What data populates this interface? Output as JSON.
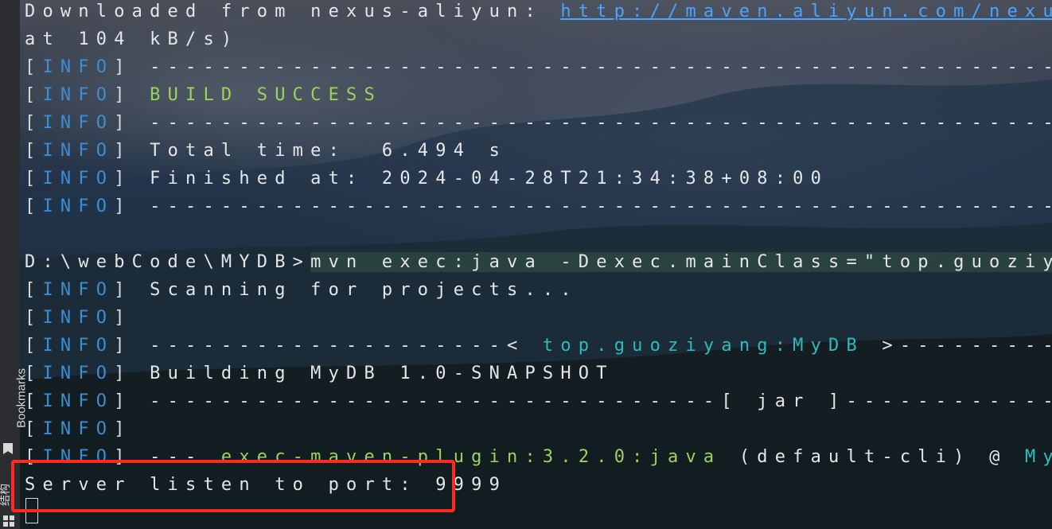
{
  "sidebar": {
    "bookmarks_label": "Bookmarks",
    "structure_label": "结构"
  },
  "terminal": {
    "tag": "INFO",
    "dash_line": "------------------------------------------------------------------------",
    "download_prefix": "Downloaded from nexus-aliyun: ",
    "download_url": "http://maven.aliyun.com/nexus/content/g",
    "download_rate": "at 104 kB/s)",
    "build_success": "BUILD SUCCESS",
    "total_time": "Total time:  6.494 s",
    "finished_at": "Finished at: 2024-04-28T21:34:38+08:00",
    "prompt": "D:\\webCode\\MYDB>",
    "command": "mvn exec:java -Dexec.mainClass=\"top.guoziyang.mydb.ba",
    "scanning": "Scanning for projects...",
    "artifact_left": "--------------------< ",
    "artifact_name": "top.guoziyang:MyDB",
    "artifact_right": " >----------------------",
    "building": "Building MyDB 1.0-SNAPSHOT",
    "jar_left": "--------------------------------[ ",
    "jar_name": "jar",
    "jar_right": " ]---------------------------------",
    "plugin_prefix": "--- ",
    "plugin_name": "exec-maven-plugin",
    "plugin_version": ":3.2.0:java",
    "plugin_cli": " (default-cli) @ ",
    "plugin_project": "MyDB",
    "plugin_suffix": " ---",
    "server_listen": "Server listen to port: 9999"
  },
  "colors": {
    "info_tag": "#3c8dd4",
    "success": "#9bd35b",
    "artifact": "#2ebbbe",
    "highlight_box": "#ff2a1f"
  }
}
